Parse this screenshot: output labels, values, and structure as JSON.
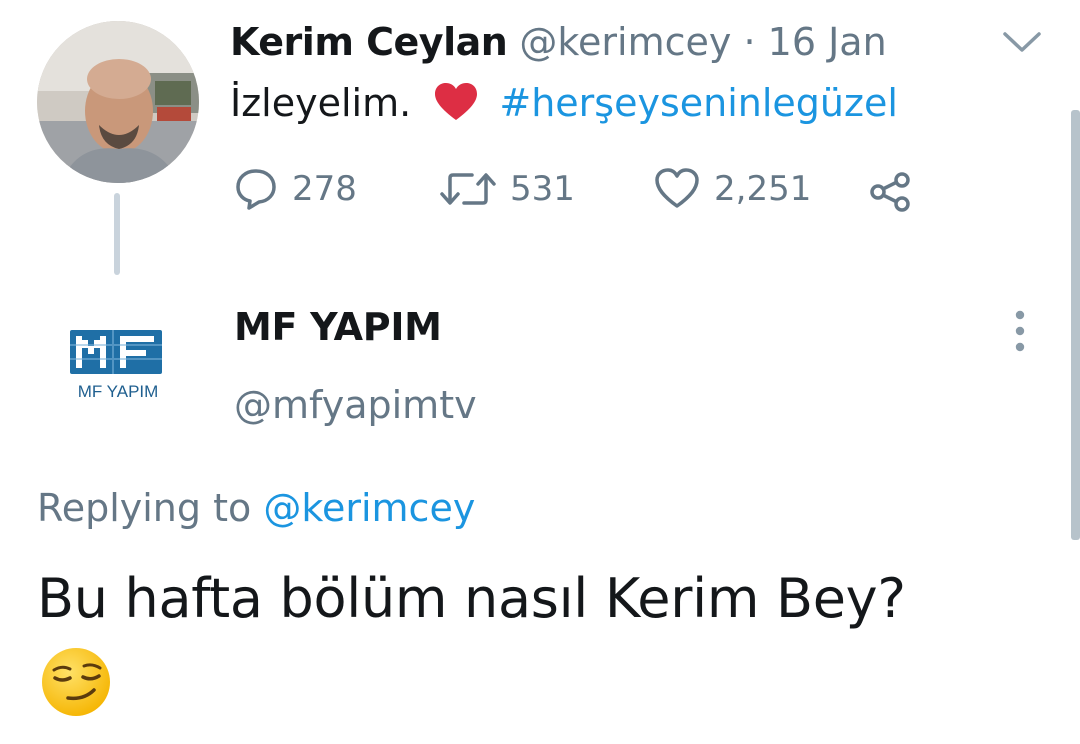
{
  "tweet": {
    "author_name": "Kerim Ceylan",
    "author_handle": "@kerimcey",
    "separator": "·",
    "time": "16 Jan",
    "text": "İzleyelim.",
    "emoji": "red-heart",
    "hashtag": "#herşeyseninlegüzel",
    "actions": {
      "replies": "278",
      "retweets": "531",
      "likes": "2,251"
    }
  },
  "reply": {
    "author_name": "MF YAPIM",
    "author_handle": "@mfyapimtv",
    "avatar_logo_text": "MF YAPIM",
    "replying_to_label": "Replying to",
    "replying_to_handle": "@kerimcey",
    "text": "Bu hafta bölüm nasıl Kerim Bey?",
    "emoji": "smirking-face"
  },
  "colors": {
    "link": "#1b95e0",
    "muted": "#657786",
    "text": "#14171a",
    "thread_line": "#c9d3dc"
  }
}
